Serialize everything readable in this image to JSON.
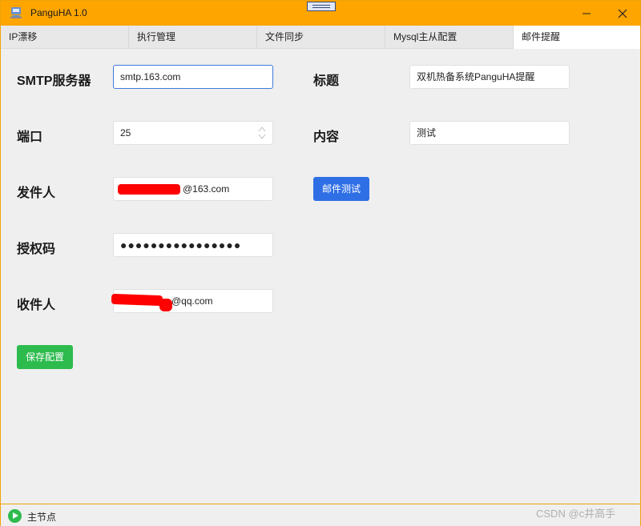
{
  "window": {
    "title": "PanguHA 1.0",
    "minimize_icon": "minimize-icon",
    "close_icon": "close-icon"
  },
  "tabs": [
    {
      "label": "IP漂移"
    },
    {
      "label": "执行管理"
    },
    {
      "label": "文件同步"
    },
    {
      "label": "Mysql主从配置"
    },
    {
      "label": "邮件提醒",
      "active": true
    }
  ],
  "form": {
    "smtp": {
      "label": "SMTP服务器",
      "value": "smtp.163.com"
    },
    "port": {
      "label": "端口",
      "value": "25"
    },
    "sender": {
      "label": "发件人",
      "value_suffix": "@163.com"
    },
    "auth": {
      "label": "授权码",
      "value": "●●●●●●●●●●●●●●●●"
    },
    "recipient": {
      "label": "收件人",
      "value_suffix": "@qq.com"
    },
    "subject": {
      "label": "标题",
      "value": "双机热备系统PanguHA提醒"
    },
    "content": {
      "label": "内容",
      "value": "测试"
    },
    "test_button": "邮件测试",
    "save_button": "保存配置"
  },
  "colors": {
    "titlebar": "#ffa500",
    "primary": "#2f6fe6",
    "success": "#2dbb4e",
    "redaction": "#ff0000"
  },
  "status": {
    "text": "主节点",
    "icon": "play-icon"
  },
  "watermark": "CSDN @c井高手"
}
